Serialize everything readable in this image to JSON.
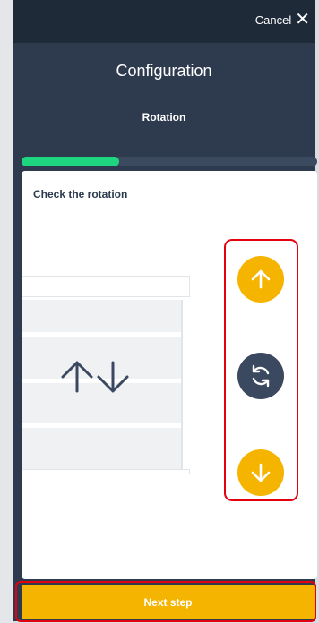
{
  "header": {
    "cancel_label": "Cancel",
    "close_icon": "close-icon"
  },
  "page": {
    "title": "Configuration",
    "step": "Rotation",
    "progress_fraction": 0.33
  },
  "card": {
    "heading": "Check the rotation",
    "illustration": "blind-icon",
    "controls": {
      "up_icon": "arrow-up-icon",
      "rotate_icon": "rotate-icon",
      "down_icon": "arrow-down-icon"
    }
  },
  "footer": {
    "next_label": "Next step"
  },
  "colors": {
    "background": "#2e3b4e",
    "topbar": "#1f2a39",
    "progress": "#1fd680",
    "accent": "#f5b400",
    "dark_button": "#3a4960",
    "highlight": "#e3000f"
  }
}
